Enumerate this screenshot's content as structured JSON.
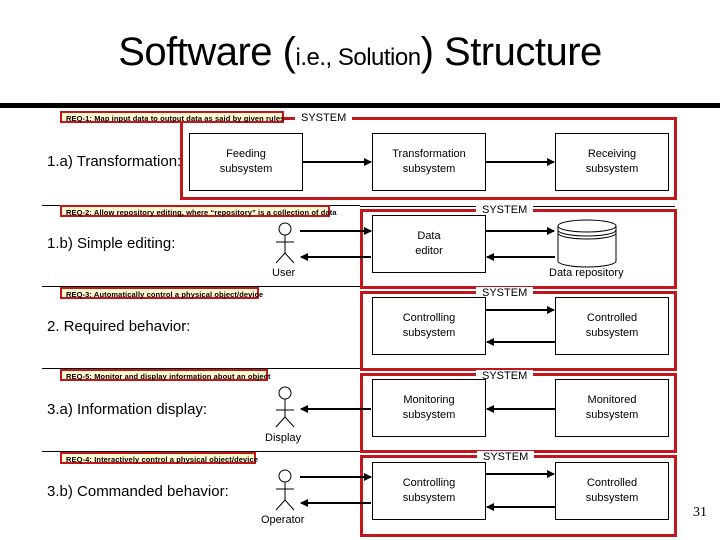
{
  "title": {
    "part1": "Software (",
    "part2": "i.e., Solution",
    "part3": ") Structure"
  },
  "page_number": "31",
  "system_label": "SYSTEM",
  "sections": [
    {
      "req": "REQ-1: Map input data to output data as said by given rules",
      "heading": "1.a) Transformation:",
      "boxes": [
        "Feeding subsystem",
        "Transformation subsystem",
        "Receiving subsystem"
      ]
    },
    {
      "req": "REQ-2: Allow repository editing, where “repository” is a collection of data",
      "heading": "1.b) Simple editing:",
      "actor": "User",
      "boxes": [
        "Data editor"
      ],
      "repository": "Data repository"
    },
    {
      "req": "REQ-3: Automatically control a physical object/device",
      "heading": "2. Required behavior:",
      "boxes": [
        "Controlling subsystem",
        "Controlled subsystem"
      ]
    },
    {
      "req": "REQ-5: Monitor and display information about an object",
      "heading": "3.a) Information display:",
      "actor": "Display",
      "boxes": [
        "Monitoring subsystem",
        "Monitored subsystem"
      ]
    },
    {
      "req": "REQ-4: Interactively control a physical object/device",
      "heading": "3.b) Commanded behavior:",
      "actor": "Operator",
      "boxes": [
        "Controlling subsystem",
        "Controlled subsystem"
      ]
    }
  ],
  "colors": {
    "frame": "#c0161c",
    "req_background": "#fff8d0"
  }
}
